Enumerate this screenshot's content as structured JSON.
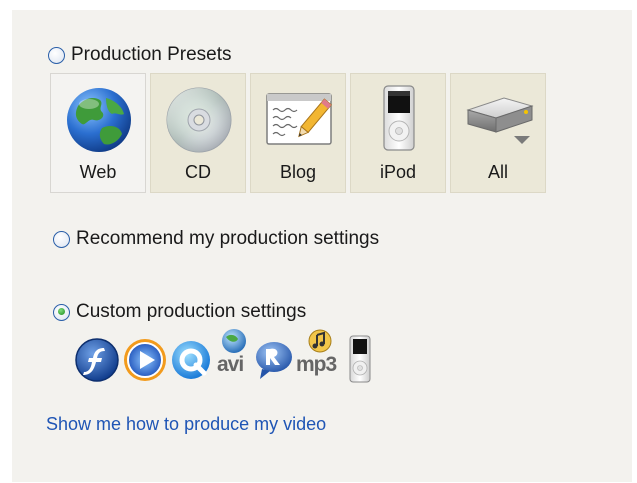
{
  "options": {
    "presets": {
      "label": "Production Presets",
      "selected": false
    },
    "recommend": {
      "label": "Recommend my production settings",
      "selected": false
    },
    "custom": {
      "label": "Custom production settings",
      "selected": true
    }
  },
  "presets": [
    {
      "label": "Web",
      "icon": "globe-icon",
      "selected": true
    },
    {
      "label": "CD",
      "icon": "cd-disc-icon",
      "selected": false
    },
    {
      "label": "Blog",
      "icon": "blog-pencil-icon",
      "selected": false
    },
    {
      "label": "iPod",
      "icon": "ipod-icon",
      "selected": false
    },
    {
      "label": "All",
      "icon": "drive-dropdown-icon",
      "selected": false
    }
  ],
  "formats": [
    {
      "icon": "flash-icon"
    },
    {
      "icon": "windows-media-icon"
    },
    {
      "icon": "quicktime-icon"
    },
    {
      "icon": "avi-icon",
      "text": "avi"
    },
    {
      "icon": "realmedia-icon"
    },
    {
      "icon": "mp3-icon",
      "text": "mp3"
    },
    {
      "icon": "ipod-small-icon"
    }
  ],
  "help_link": "Show me how to produce my video",
  "colors": {
    "panel_bg": "#f3f2ee",
    "preset_bg": "#ebe8d8",
    "link": "#1f55b5",
    "radio_border": "#2a5fa8"
  }
}
